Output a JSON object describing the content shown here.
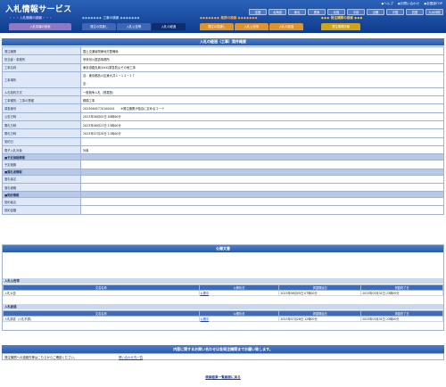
{
  "header": {
    "title": "入札情報サービス",
    "links": [
      "◆ヘルプ",
      "◆お問い合わせ",
      "◆全国版TOP"
    ],
    "regions": [
      "全国",
      "北海道",
      "東北",
      "関東",
      "北陸",
      "中部",
      "近畿",
      "中国",
      "四国",
      "九州沖縄"
    ]
  },
  "categories": {
    "search_text": "入札情報の検索",
    "construction": "工事の検索",
    "consult": "業務の検索",
    "org": "発注機関の検索"
  },
  "tabs": [
    {
      "label": "入札情報の検索",
      "style": "purple"
    },
    {
      "label": "発注の見通し",
      "style": "blue"
    },
    {
      "label": "入札公告等",
      "style": "blue"
    },
    {
      "label": "入札の経過",
      "style": "active"
    },
    {
      "label": "発注の見通し",
      "style": "orange"
    },
    {
      "label": "入札公告等",
      "style": "orange"
    },
    {
      "label": "入札の経過",
      "style": "orange"
    },
    {
      "label": "発注機関情報",
      "style": "yellow"
    }
  ],
  "page_title": "入札の経過（工事）案件概要",
  "details": [
    {
      "label": "発注機関",
      "value": "国土交通省関東地方整備局",
      "type": "row"
    },
    {
      "label": "担当部・事務所",
      "value": "甲府河川国道事務所",
      "type": "row"
    },
    {
      "label": "工事名称",
      "value": "東京道路支局(XXX)緊急防災その他工事",
      "type": "row"
    },
    {
      "label": "工事場所",
      "value": "自：東京都品川区東大井１−１２−１７",
      "value2": "至：",
      "type": "tall"
    },
    {
      "label": "入札契約方式",
      "value": "一般競争入札（簡易型）",
      "type": "row"
    },
    {
      "label": "工事種別／工事の業種",
      "value": "鋼橋工事",
      "type": "row"
    },
    {
      "label": "調査番号",
      "value": "20230605770100001　　※発注機関が独自に定めるコード",
      "type": "row"
    },
    {
      "label": "公告日時",
      "value": "2023年06月05日 00時00分",
      "type": "row"
    },
    {
      "label": "開札日時",
      "value": "2023年06月23日 15時00分",
      "type": "row"
    },
    {
      "label": "開札日時",
      "value": "2023年07月28日 11時00分",
      "type": "row"
    },
    {
      "label": "契約日",
      "value": "",
      "type": "row"
    },
    {
      "label": "電子入札対象",
      "value": "対象",
      "type": "row"
    },
    {
      "label": "■予定価格情報",
      "value": "",
      "type": "sect"
    },
    {
      "label": "予定価格",
      "value": "",
      "type": "row"
    },
    {
      "label": "■落札者情報",
      "value": "",
      "type": "sect"
    },
    {
      "label": "落札者名",
      "value": "",
      "type": "row"
    },
    {
      "label": "落札価格",
      "value": "",
      "type": "row"
    },
    {
      "label": "■契約情報",
      "value": "",
      "type": "sect"
    },
    {
      "label": "契約者名",
      "value": "",
      "type": "row"
    },
    {
      "label": "契約金額",
      "value": "",
      "type": "row"
    }
  ],
  "documents": {
    "title": "公開文書",
    "headers": [
      "文書名称",
      "公開状況",
      "掲載開始日",
      "掲載終了日"
    ],
    "section1": {
      "name": "入札公告等",
      "rows": [
        [
          "入札公告",
          "公開中",
          "2023年06月05日 07時00分",
          "2023年03月31日 23時00分"
        ]
      ]
    },
    "section2": {
      "name": "入札経過",
      "rows": [
        [
          "入札調書（入札不調）",
          "公開中",
          "2023年07月28日 12時00分",
          "2023年03月31日 23時00分"
        ]
      ]
    }
  },
  "contact": {
    "bar": "内容に関するお問い合わせは各発注機関までお願い致します。",
    "text": "発注機関への連絡先等はこちらからご確認ください。",
    "link": "問い合わせ先一覧"
  },
  "back_link": "検索結果一覧画面に戻る",
  "colors": {
    "header": "#1a4aa0",
    "bar": "#3d6ab8",
    "label_bg": "#dde7f5"
  }
}
